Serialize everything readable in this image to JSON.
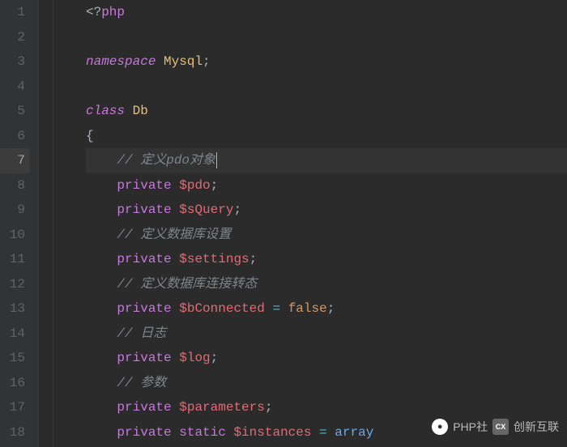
{
  "lines": [
    {
      "num": "1",
      "tokens": [
        {
          "t": "<?",
          "c": "php-tag"
        },
        {
          "t": "php",
          "c": "kw-private"
        }
      ]
    },
    {
      "num": "2",
      "tokens": []
    },
    {
      "num": "3",
      "tokens": [
        {
          "t": "namespace",
          "c": "kw-namespace"
        },
        {
          "t": " ",
          "c": ""
        },
        {
          "t": "Mysql",
          "c": "identifier"
        },
        {
          "t": ";",
          "c": "punct"
        }
      ]
    },
    {
      "num": "4",
      "tokens": []
    },
    {
      "num": "5",
      "tokens": [
        {
          "t": "class",
          "c": "kw-class"
        },
        {
          "t": " ",
          "c": ""
        },
        {
          "t": "Db",
          "c": "identifier"
        }
      ]
    },
    {
      "num": "6",
      "tokens": [
        {
          "t": "{",
          "c": "brace"
        }
      ]
    },
    {
      "num": "7",
      "current": true,
      "indent": 1,
      "tokens": [
        {
          "t": "// 定义pdo对象",
          "c": "comment"
        }
      ],
      "cursor": true
    },
    {
      "num": "8",
      "indent": 1,
      "tokens": [
        {
          "t": "private",
          "c": "kw-private"
        },
        {
          "t": " ",
          "c": ""
        },
        {
          "t": "$pdo",
          "c": "var-name"
        },
        {
          "t": ";",
          "c": "punct"
        }
      ]
    },
    {
      "num": "9",
      "indent": 1,
      "tokens": [
        {
          "t": "private",
          "c": "kw-private"
        },
        {
          "t": " ",
          "c": ""
        },
        {
          "t": "$sQuery",
          "c": "var-name"
        },
        {
          "t": ";",
          "c": "punct"
        }
      ]
    },
    {
      "num": "10",
      "indent": 1,
      "tokens": [
        {
          "t": "// 定义数据库设置",
          "c": "comment"
        }
      ]
    },
    {
      "num": "11",
      "indent": 1,
      "tokens": [
        {
          "t": "private",
          "c": "kw-private"
        },
        {
          "t": " ",
          "c": ""
        },
        {
          "t": "$settings",
          "c": "var-name"
        },
        {
          "t": ";",
          "c": "punct"
        }
      ]
    },
    {
      "num": "12",
      "indent": 1,
      "tokens": [
        {
          "t": "// 定义数据库连接转态",
          "c": "comment"
        }
      ]
    },
    {
      "num": "13",
      "indent": 1,
      "tokens": [
        {
          "t": "private",
          "c": "kw-private"
        },
        {
          "t": " ",
          "c": ""
        },
        {
          "t": "$bConnected",
          "c": "var-name"
        },
        {
          "t": " ",
          "c": ""
        },
        {
          "t": "=",
          "c": "operator"
        },
        {
          "t": " ",
          "c": ""
        },
        {
          "t": "false",
          "c": "kw-false"
        },
        {
          "t": ";",
          "c": "punct"
        }
      ]
    },
    {
      "num": "14",
      "indent": 1,
      "tokens": [
        {
          "t": "// 日志",
          "c": "comment"
        }
      ]
    },
    {
      "num": "15",
      "indent": 1,
      "tokens": [
        {
          "t": "private",
          "c": "kw-private"
        },
        {
          "t": " ",
          "c": ""
        },
        {
          "t": "$log",
          "c": "var-name"
        },
        {
          "t": ";",
          "c": "punct"
        }
      ]
    },
    {
      "num": "16",
      "indent": 1,
      "tokens": [
        {
          "t": "// 参数",
          "c": "comment"
        }
      ]
    },
    {
      "num": "17",
      "indent": 1,
      "tokens": [
        {
          "t": "private",
          "c": "kw-private"
        },
        {
          "t": " ",
          "c": ""
        },
        {
          "t": "$parameters",
          "c": "var-name"
        },
        {
          "t": ";",
          "c": "punct"
        }
      ]
    },
    {
      "num": "18",
      "indent": 1,
      "tokens": [
        {
          "t": "private",
          "c": "kw-private"
        },
        {
          "t": " ",
          "c": ""
        },
        {
          "t": "static",
          "c": "kw-static"
        },
        {
          "t": " ",
          "c": ""
        },
        {
          "t": "$instances",
          "c": "var-name"
        },
        {
          "t": " ",
          "c": ""
        },
        {
          "t": "=",
          "c": "operator"
        },
        {
          "t": " ",
          "c": ""
        },
        {
          "t": "array",
          "c": "func"
        }
      ]
    }
  ],
  "watermark": {
    "text1": "PHP社",
    "text2": "创新互联"
  }
}
